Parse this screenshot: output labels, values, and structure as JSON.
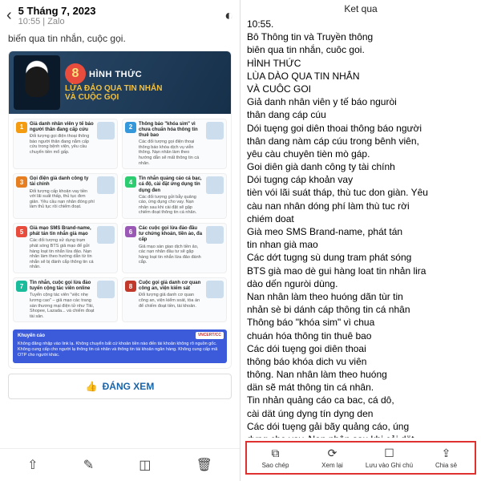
{
  "left": {
    "date": "5 Tháng 7, 2023",
    "time": "10:55",
    "app": "Zalo",
    "blurb_suffix": "biến qua tin nhắn, cuộc gọi.",
    "hero": {
      "num": "8",
      "line1": "HÌNH THỨC",
      "line2": "LỪA ĐẢO QUA TIN NHẮN",
      "line3": "VÀ CUỘC GỌI"
    },
    "cards": [
      {
        "n": "1",
        "b": "b1",
        "t": "Giả danh nhân viên y tế báo người thân đang cấp cứu",
        "d": "Đối tượng gọi điện thoại thông báo người thân đang nằm cấp cứu trong bệnh viện, yêu cầu chuyển tiền mổ gấp."
      },
      {
        "n": "2",
        "b": "b2",
        "t": "Thông báo \"khóa sim\" vì chưa chuẩn hóa thông tin thuê bao",
        "d": "Các đối tượng gọi điện thoại thông báo khóa dịch vụ viễn thông. Nạn nhân làm theo hướng dẫn sẽ mất thông tin cá nhân."
      },
      {
        "n": "3",
        "b": "b3",
        "t": "Gọi điện giả danh công ty tài chính",
        "d": "Đối tượng cấp khoản vay tiền với lãi suất thấp, thủ tục đơn giản. Yêu cầu nạn nhân đóng phí làm thủ tục rồi chiếm đoạt."
      },
      {
        "n": "4",
        "b": "b4",
        "t": "Tin nhắn quảng cáo cá bạc, cá độ, cài đặt ứng dụng tín dụng đen",
        "d": "Các đối tượng gửi bẫy quảng cáo, ứng dụng cho vay. Nạn nhân sau khi cài đặt sẽ gặp chiếm đoạt thông tin cá nhân."
      },
      {
        "n": "5",
        "b": "b5",
        "t": "Giả mạo SMS Brand-name, phát tán tin nhắn giả mạo",
        "d": "Các đối tượng sử dụng trạm phát sóng BTS giả mạo để gửi hàng loạt tin nhắn lừa đảo. Nạn nhân làm theo hướng dẫn từ tin nhắn sẽ bị đánh cắp thông tin cá nhân."
      },
      {
        "n": "6",
        "b": "b6",
        "t": "Các cuộc gọi lừa đảo đầu tư chứng khoán, tiền ảo, đa cấp",
        "d": "Giả mạo sàn giao dịch tiền ảo, các nạn nhân đầu tư sẽ gặp hàng loạt tin nhắn lừa đảo đánh cắp."
      },
      {
        "n": "7",
        "b": "b7",
        "t": "Tin nhắn, cuộc gọi lừa đảo tuyển cộng tác viên online",
        "d": "Tuyển cộng tác viên \"việc nhẹ lương cao\" – giả mạo các trang sàn thương mại điện tử như Tiki, Shopee, Lazada... và chiếm đoạt tài sản."
      },
      {
        "n": "8",
        "b": "b8",
        "t": "Cuộc gọi giả danh cơ quan công an, viện kiểm sát",
        "d": "Đối tượng giả danh cơ quan công an, viện kiểm soát, tòa án để chiếm đoạt tiền, tài khoản."
      }
    ],
    "tip_label": "Khuyến cáo",
    "tip": "Không đăng nhập vào link lạ.\nKhông chuyển bất cứ khoản tiền nào đến tài khoản không rõ nguồn gốc.\nKhông cung cấp cho người lạ thông tin cá nhân và thông tin tài khoản ngân hàng.\nKhông cung cấp mã OTP cho người khác.",
    "vncert": "VNCERT/CC",
    "worth": "ĐÁNG XEM"
  },
  "right": {
    "title": "Ket qua",
    "body": "10:55.\nBô Thông tin và Truyền thông\nbiên qua tin nhắn, cuôc goi.\nHÌNH THỨC\nLÙA DÀO QUA TIN NHẮN\nVÀ CUÔC GOI\nGiả danh nhân viên y tế báo nguròi\nthân dang cáp cúu\nDói tuȩng goi diên thoai thông báo người\nthân dang nàm cáp cúu trong bênh viên,\nyêu càu chuyên tièn mò gáp.\nGoi diên già danh công ty tài chính\nDói tugng cáp khoản vay\ntièn vói lãi suát tháp, thù tuc don giàn. Yêu\ncàu nan nhân dóng phí làm thù tuc rời\nchiém doat\nGià meo SMS Brand-name, phát tán\ntin nhan già mao\nCác dớt tugng sù dung tram phát sóng\nBTS già mao dè gui hàng loat tin nhản lira\ndào dến nguròi dùng.\nNan nhân làm theo huóng dãn tùr tin\nnhản sè bi dánh cáp thông tin cá nhân\nThông báo \"khóa sim\" vì chua\nchuán hóa thông tin thuê bao\nCác dói tuȩng goi diên thoai\nthông báo khóa dich vu viên\nthông. Nan nhân làm theo huóng\ndän sẽ mát thông tin cá nhân.\nTin nhản quảng cáo ca bac, cá dô,\ncài dät úng dyng tín dyng den\nCác dói tuȩng gải bãy quảng cáo, úng\ndyng cho vay. Nan nhân sau khi cải dät",
    "bar": [
      {
        "icon": "⧉",
        "label": "Sao chép"
      },
      {
        "icon": "⟳",
        "label": "Xem lại"
      },
      {
        "icon": "☐",
        "label": "Lưu vào Ghi chú"
      },
      {
        "icon": "⇪",
        "label": "Chia sẻ"
      }
    ]
  }
}
